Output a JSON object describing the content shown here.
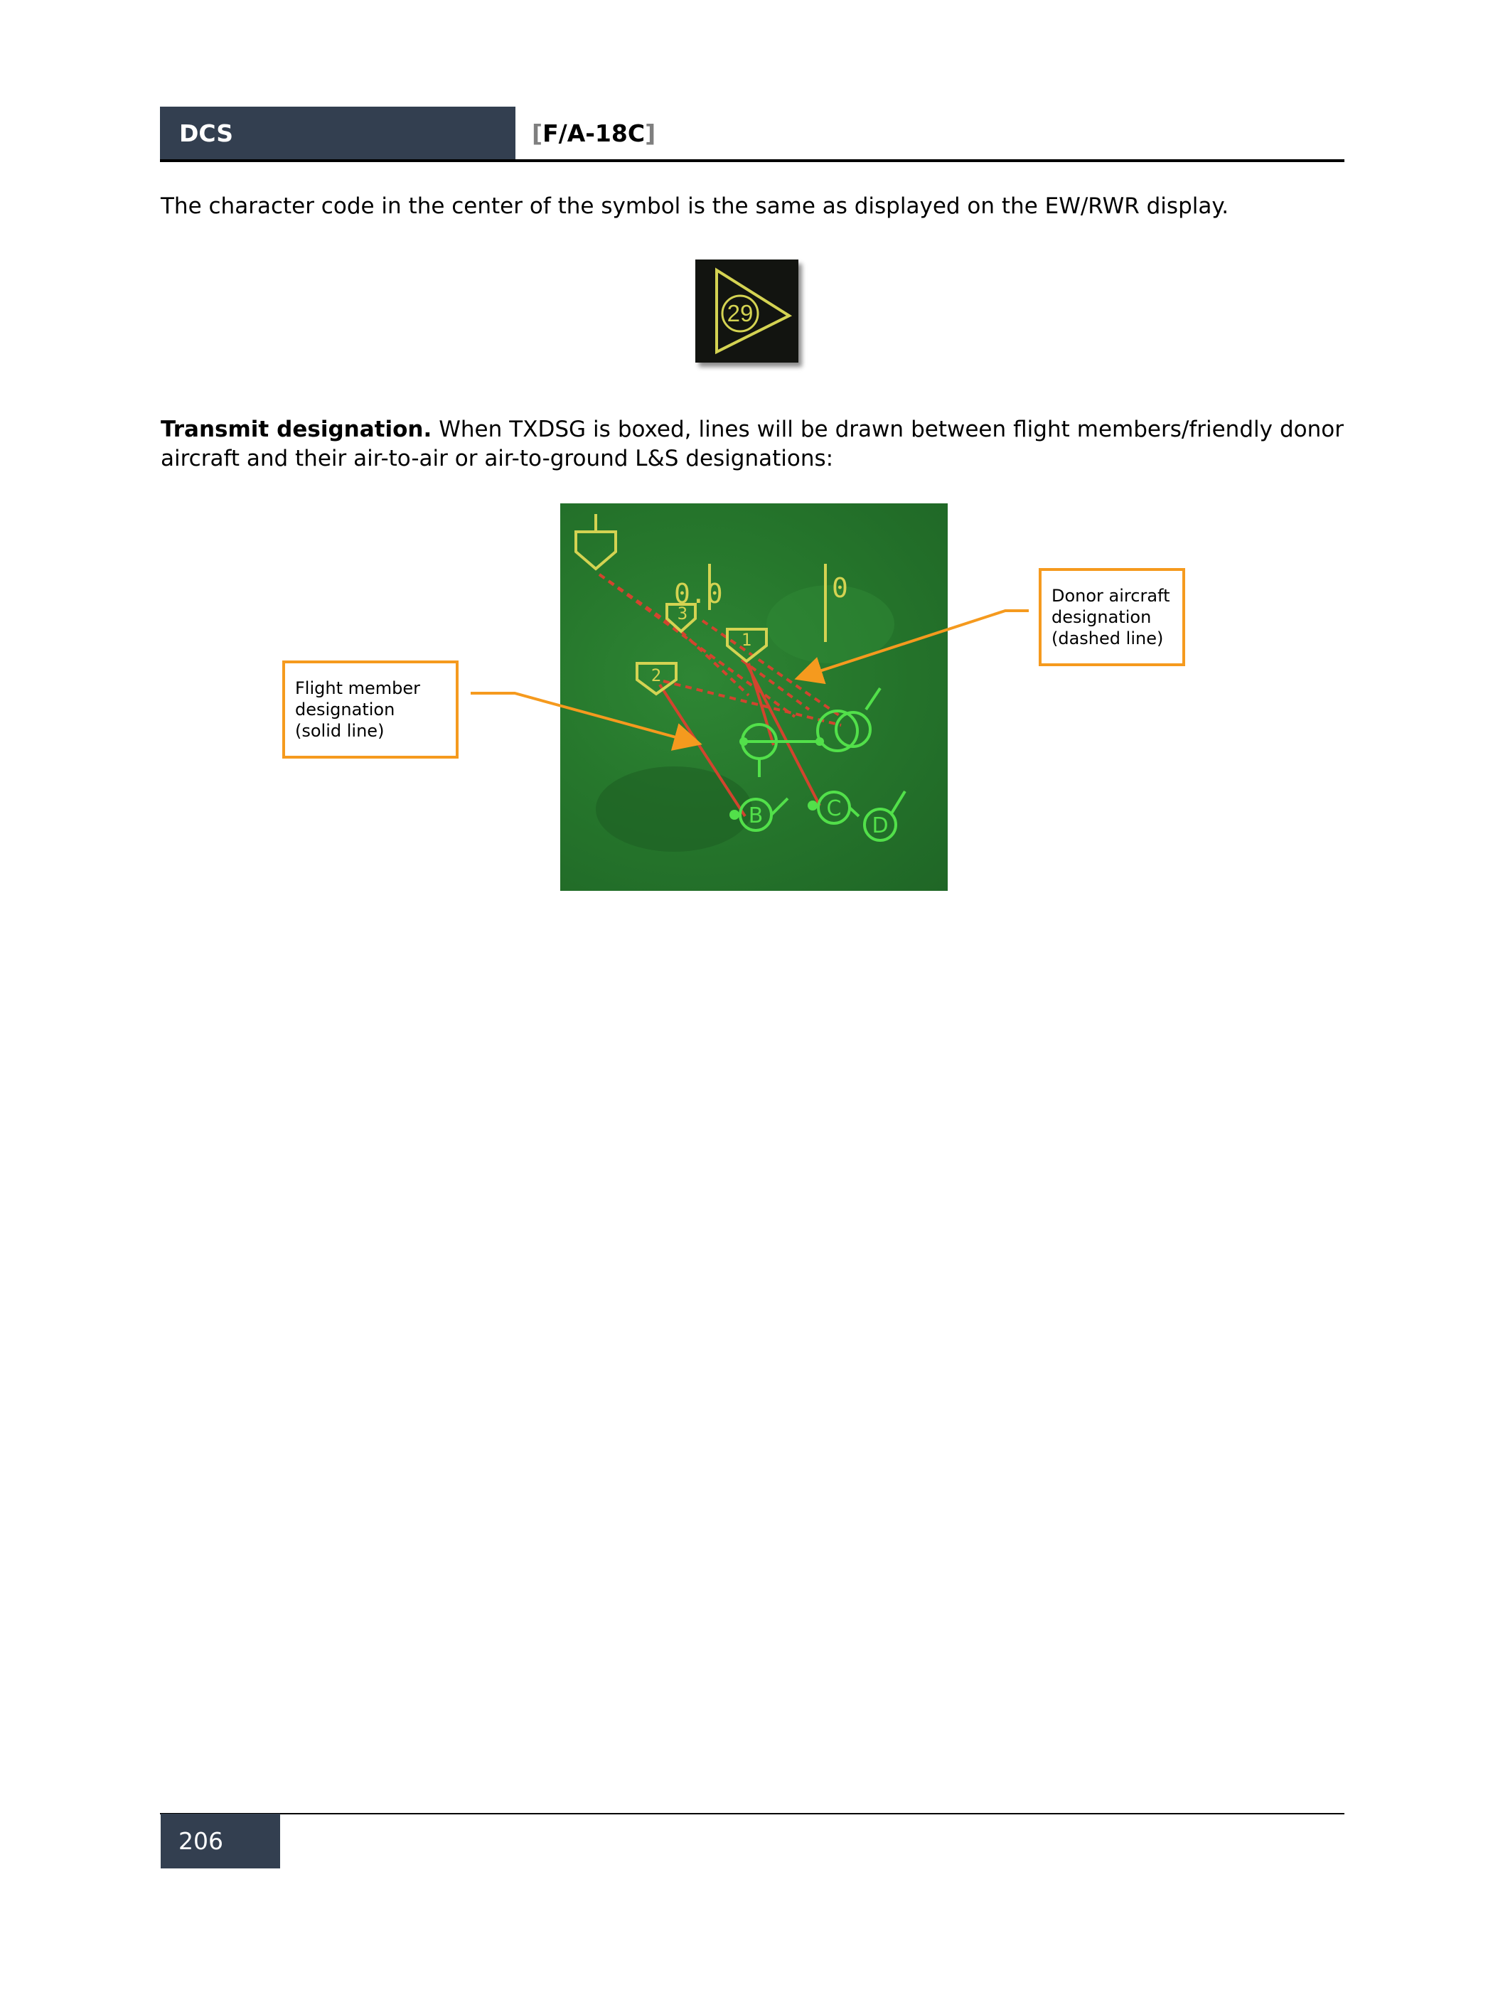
{
  "header": {
    "product": "DCS",
    "bracket_open": "[",
    "aircraft": "F/A-18C",
    "bracket_close": "]"
  },
  "body": {
    "intro": "The character code in the center of the symbol is the same as displayed on the EW/RWR display.",
    "txdsg_heading": "Transmit designation.",
    "txdsg_text": " When TXDSG is boxed, lines will be drawn between flight members/friendly donor aircraft and their air-to-air or air-to-ground L&S designations:"
  },
  "rwr_symbol": {
    "code": "29"
  },
  "radar_figure": {
    "labels": {
      "flight_3": "3",
      "flight_1": "1",
      "flight_2": "2",
      "target_b": "B",
      "target_c": "C",
      "target_d": "D",
      "readout_left": "0.0",
      "readout_right": "0"
    }
  },
  "callouts": {
    "flight_member": "Flight member designation (solid line)",
    "donor": "Donor aircraft designation (dashed line)"
  },
  "colors": {
    "header_bg": "#333f50",
    "callout_border": "#f59a1e",
    "radar_green": "#26772c",
    "symbol_yellow": "#d4d352",
    "target_green": "#52e04a",
    "designation_red": "#d2442e"
  },
  "footer": {
    "page_number": "206"
  }
}
